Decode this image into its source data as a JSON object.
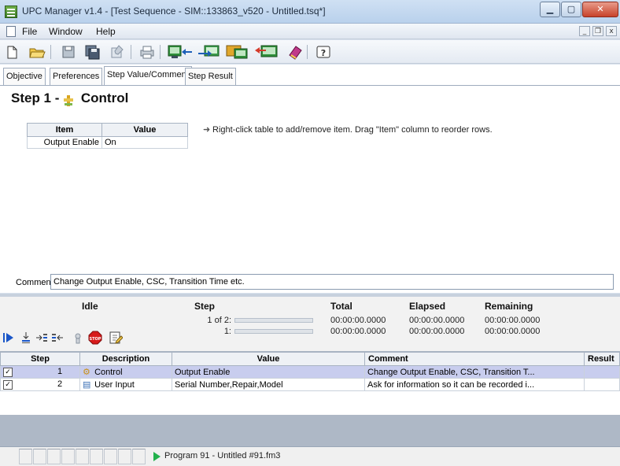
{
  "window": {
    "title": "UPC Manager v1.4 - [Test Sequence - SIM::133863_v520 - Untitled.tsq*]"
  },
  "menu": {
    "items": [
      "File",
      "Window",
      "Help"
    ]
  },
  "toolbar": {
    "buttons": [
      "new-file-icon",
      "open-folder-icon",
      "save-icon",
      "save-all-icon",
      "properties-icon",
      "print-icon",
      "import-icon",
      "export-icon",
      "upload-icon",
      "download-icon",
      "book-icon",
      "help-icon"
    ]
  },
  "tabs": [
    {
      "label": "Objective",
      "active": false
    },
    {
      "label": "Preferences",
      "active": false
    },
    {
      "label": "Step Value/Comment",
      "active": true
    },
    {
      "label": "Step Result",
      "active": false
    }
  ],
  "step": {
    "title_prefix": "Step 1 -",
    "title_name": "Control",
    "table_headers": [
      "Item",
      "Value"
    ],
    "table_rows": [
      {
        "item": "Output Enable",
        "value": "On"
      }
    ],
    "hint": "Right-click table to add/remove item. Drag \"Item\" column to reorder rows.",
    "comment_label": "Comment:",
    "comment_value": "Change Output Enable, CSC, Transition Time etc."
  },
  "status": {
    "state": "Idle",
    "headers": {
      "step": "Step",
      "total": "Total",
      "elapsed": "Elapsed",
      "remaining": "Remaining"
    },
    "step_line1": "1 of 2:",
    "step_line2": "1:",
    "progress1": 0.0,
    "progress2": 0.0,
    "total": [
      "00:00:00.0000",
      "00:00:00.0000"
    ],
    "elapsed": [
      "00:00:00.0000",
      "00:00:00.0000"
    ],
    "remaining": [
      "00:00:00.0000",
      "00:00:00.0000"
    ]
  },
  "steps_table": {
    "headers": [
      "Step",
      "Description",
      "Value",
      "Comment",
      "Result"
    ],
    "rows": [
      {
        "checked": true,
        "step": "1",
        "description": "Control",
        "value": "Output Enable",
        "comment": "Change Output Enable, CSC, Transition T...",
        "result": "",
        "selected": true
      },
      {
        "checked": true,
        "step": "2",
        "description": "User Input",
        "value": "Serial Number,Repair,Model",
        "comment": "Ask for information so it can be recorded i...",
        "result": "",
        "selected": false
      }
    ]
  },
  "statusbar": {
    "program": "Program 91 - Untitled #91.fm3"
  }
}
